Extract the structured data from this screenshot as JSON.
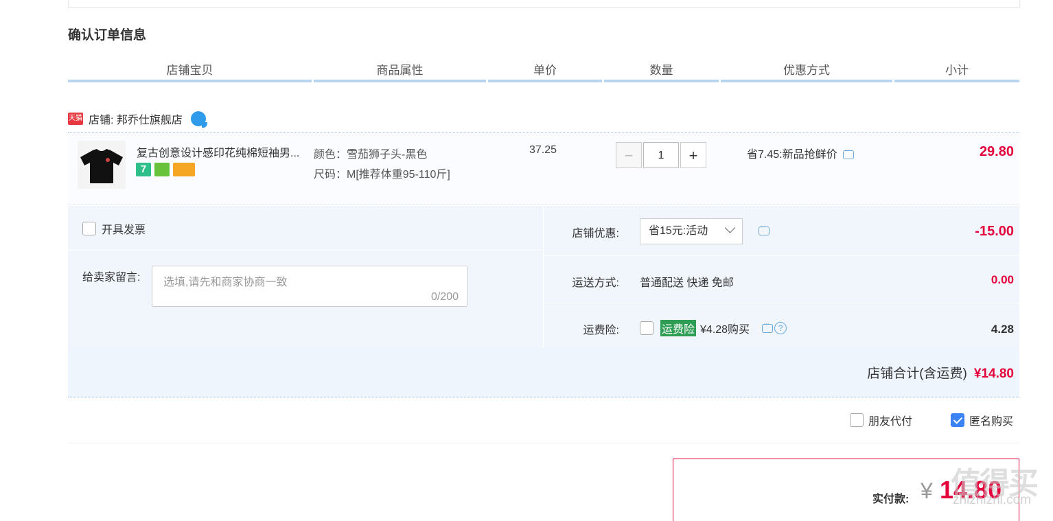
{
  "section_title": "确认订单信息",
  "table_headers": [
    "店铺宝贝",
    "商品属性",
    "单价",
    "数量",
    "优惠方式",
    "小计"
  ],
  "shop": {
    "badge": "天猫",
    "label": "店铺: 邦乔仕旗舰店"
  },
  "item": {
    "title": "复古创意设计感印花纯棉短袖男...",
    "service_badge": "7",
    "attrs": [
      "颜色：雪茄狮子头-黑色",
      "尺码：M[推荐体重95-110斤]"
    ],
    "unit_price": "37.25",
    "qty_minus": "−",
    "quantity": "1",
    "qty_plus": "+",
    "discount": "省7.45:新品抢鲜价",
    "subtotal": "29.80"
  },
  "invoice_label": "开具发票",
  "message": {
    "label": "给卖家留言:",
    "placeholder": "选填,请先和商家协商一致",
    "count": "0/200"
  },
  "store_discount": {
    "label": "店铺优惠:",
    "selected": "省15元:活动",
    "value": "-15.00"
  },
  "shipping": {
    "label": "运送方式:",
    "method": "普通配送 快递 免邮",
    "value": "0.00"
  },
  "insurance": {
    "label": "运费险:",
    "badge": "运费险",
    "text": "¥4.28购买",
    "qmark": "?",
    "value": "4.28"
  },
  "store_total": {
    "label": "店铺合计(含运费)",
    "value": "¥14.80"
  },
  "friend_pay": "朋友代付",
  "anonymous": "匿名购买",
  "pay": {
    "label": "实付款:",
    "currency": "¥",
    "amount": "14.80"
  },
  "watermark": {
    "text": "值得买",
    "url": "zhizhizhi.com"
  },
  "colors": {
    "price_red": "#e4003a",
    "header_line": "#b9d4ee",
    "panel_bg": "#f1f6fd"
  }
}
